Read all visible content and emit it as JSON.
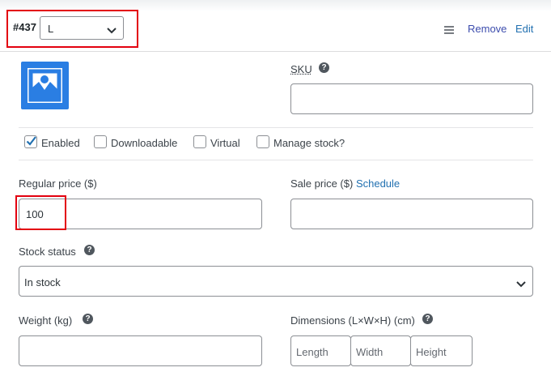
{
  "header": {
    "variation_id": "#437",
    "attribute_value": "L",
    "remove_label": "Remove",
    "edit_label": "Edit"
  },
  "thumbnail": {
    "icon": "image-placeholder-icon"
  },
  "sku": {
    "label": "SKU",
    "help": "?",
    "value": ""
  },
  "options": [
    {
      "label": "Enabled",
      "checked": true
    },
    {
      "label": "Downloadable",
      "checked": false
    },
    {
      "label": "Virtual",
      "checked": false
    },
    {
      "label": "Manage stock?",
      "checked": false
    }
  ],
  "regular_price": {
    "label": "Regular price ($)",
    "value": "100"
  },
  "sale_price": {
    "label": "Sale price ($)",
    "schedule_link": "Schedule",
    "value": ""
  },
  "stock_status": {
    "label": "Stock status",
    "help": "?",
    "selected": "In stock"
  },
  "weight": {
    "label": "Weight (kg)",
    "help": "?",
    "value": ""
  },
  "dimensions": {
    "label": "Dimensions (L×W×H) (cm)",
    "help": "?",
    "length_placeholder": "Length",
    "width_placeholder": "Width",
    "height_placeholder": "Height"
  },
  "colors": {
    "accent": "#2271b1",
    "highlight": "#e3000f",
    "thumbnail": "#2a7ee3"
  }
}
